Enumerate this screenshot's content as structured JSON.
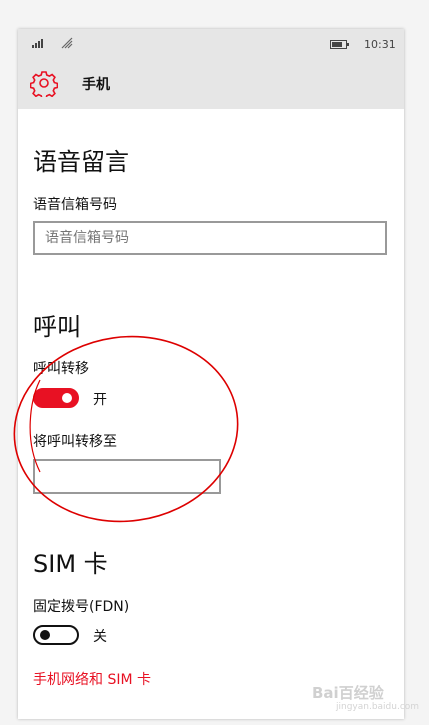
{
  "status_bar": {
    "time": "10:31",
    "icons": [
      "signal-icon",
      "wifi-icon",
      "battery-icon"
    ]
  },
  "header": {
    "icon": "gear-icon",
    "title": "手机"
  },
  "voicemail": {
    "section_title": "语音留言",
    "number_label": "语音信箱号码",
    "number_placeholder": "语音信箱号码",
    "number_value": ""
  },
  "call": {
    "section_title": "呼叫",
    "forwarding_label": "呼叫转移",
    "forwarding_state": "开",
    "forwarding_on": true,
    "forward_to_label": "将呼叫转移至",
    "forward_to_value": ""
  },
  "sim": {
    "section_title": "SIM 卡",
    "fdn_label": "固定拨号(FDN)",
    "fdn_state": "关",
    "fdn_on": false,
    "network_link": "手机网络和 SIM 卡"
  },
  "colors": {
    "accent": "#e81123",
    "header_bg": "#e6e6e6",
    "annotation": "#dd0000"
  },
  "watermark": {
    "brand": "Bai百经验",
    "sub": "jingyan.baidu.com"
  }
}
